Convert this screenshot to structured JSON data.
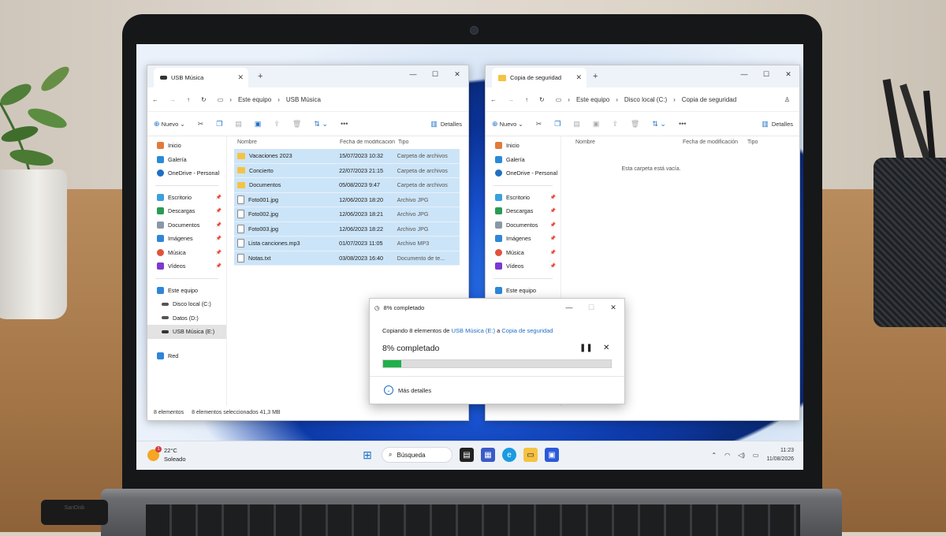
{
  "left_window": {
    "tab_title": "USB Música",
    "breadcrumb": [
      "Este equipo",
      "USB Música"
    ],
    "toolbar": {
      "new_label": "Nuevo",
      "details_label": "Detalles"
    },
    "columns": [
      "Nombre",
      "Fecha de modificación",
      "Tipo"
    ],
    "files": [
      {
        "name": "Vacaciones 2023",
        "date": "15/07/2023 10:32",
        "type": "Carpeta de archivos",
        "kind": "folder"
      },
      {
        "name": "Concierto",
        "date": "22/07/2023 21:15",
        "type": "Carpeta de archivos",
        "kind": "folder"
      },
      {
        "name": "Documentos",
        "date": "05/08/2023 9:47",
        "type": "Carpeta de archivos",
        "kind": "folder"
      },
      {
        "name": "Foto001.jpg",
        "date": "12/06/2023 18:20",
        "type": "Archivo JPG",
        "kind": "file"
      },
      {
        "name": "Foto002.jpg",
        "date": "12/06/2023 18:21",
        "type": "Archivo JPG",
        "kind": "file"
      },
      {
        "name": "Foto003.jpg",
        "date": "12/06/2023 18:22",
        "type": "Archivo JPG",
        "kind": "file"
      },
      {
        "name": "Lista canciones.mp3",
        "date": "01/07/2023 11:05",
        "type": "Archivo MP3",
        "kind": "file"
      },
      {
        "name": "Notas.txt",
        "date": "03/08/2023 16:40",
        "type": "Documento de te...",
        "kind": "file"
      }
    ],
    "status": {
      "count": "8 elementos",
      "selected": "8 elementos seleccionados  41,3 MB"
    }
  },
  "nav": {
    "top": [
      "Inicio",
      "Galería",
      "OneDrive - Personal"
    ],
    "quick": [
      "Escritorio",
      "Descargas",
      "Documentos",
      "Imágenes",
      "Música",
      "Vídeos"
    ],
    "this_pc": "Este equipo",
    "drives": [
      "Disco local (C:)",
      "Datos (D:)",
      "USB Música (E:)"
    ],
    "network": "Red"
  },
  "right_window": {
    "tab_title": "Copia de seguridad",
    "breadcrumb": [
      "Este equipo",
      "Disco local (C:)",
      "Copia de seguridad"
    ],
    "toolbar": {
      "new_label": "Nuevo",
      "details_label": "Detalles"
    },
    "columns": [
      "Nombre",
      "Fecha de modificación",
      "Tipo"
    ],
    "empty_text": "Esta carpeta está vacía."
  },
  "copy_dialog": {
    "title": "8% completado",
    "copying_prefix": "Copiando 8 elementos de",
    "source": "USB Música (E:)",
    "connector": "a",
    "destination": "Copia de seguridad",
    "percent_label": "8% completado",
    "progress": 0.08,
    "more_details": "Más detalles"
  },
  "taskbar": {
    "temperature": "22°C",
    "condition": "Soleado",
    "weather_badge": "1",
    "search_label": "Búsqueda",
    "time": "11:23",
    "date": "11/08/2026"
  },
  "usb_brand": "SanDisk",
  "colors": {
    "accent": "#1f6fc4",
    "selection": "#cce4f7",
    "progress": "#1fb04b",
    "folder": "#f5c342"
  }
}
